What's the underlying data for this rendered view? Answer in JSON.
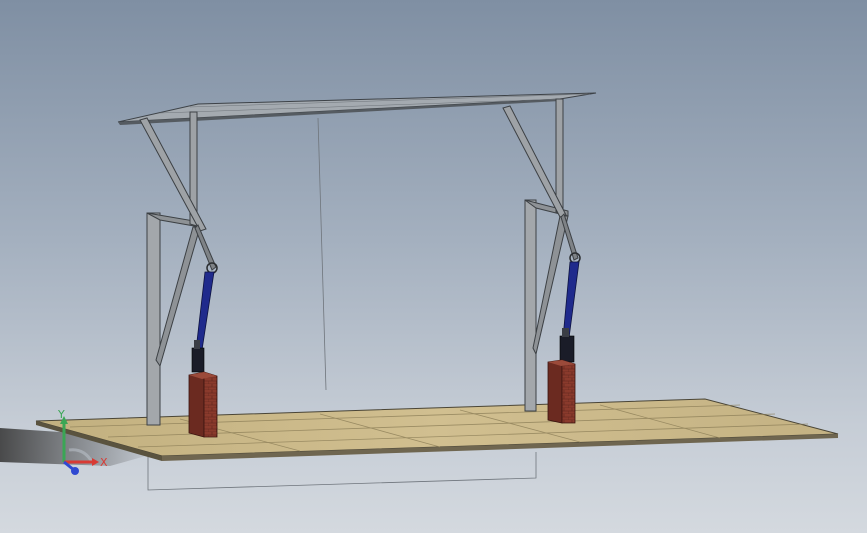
{
  "viewport": {
    "background_top": "#7f8fa3",
    "background_bottom": "#d4d9df"
  },
  "model": {
    "deck_color": "#c9b685",
    "frame_color": "#8e9296",
    "roof_color": "#9aa0a6",
    "cylinder_color": "#1f2a8c",
    "brick_color": "#8a3a2c"
  },
  "triad": {
    "x_label": "X",
    "y_label": "Y",
    "x_color": "#d83a34",
    "y_color": "#3aa655",
    "z_color": "#2f49d1"
  }
}
